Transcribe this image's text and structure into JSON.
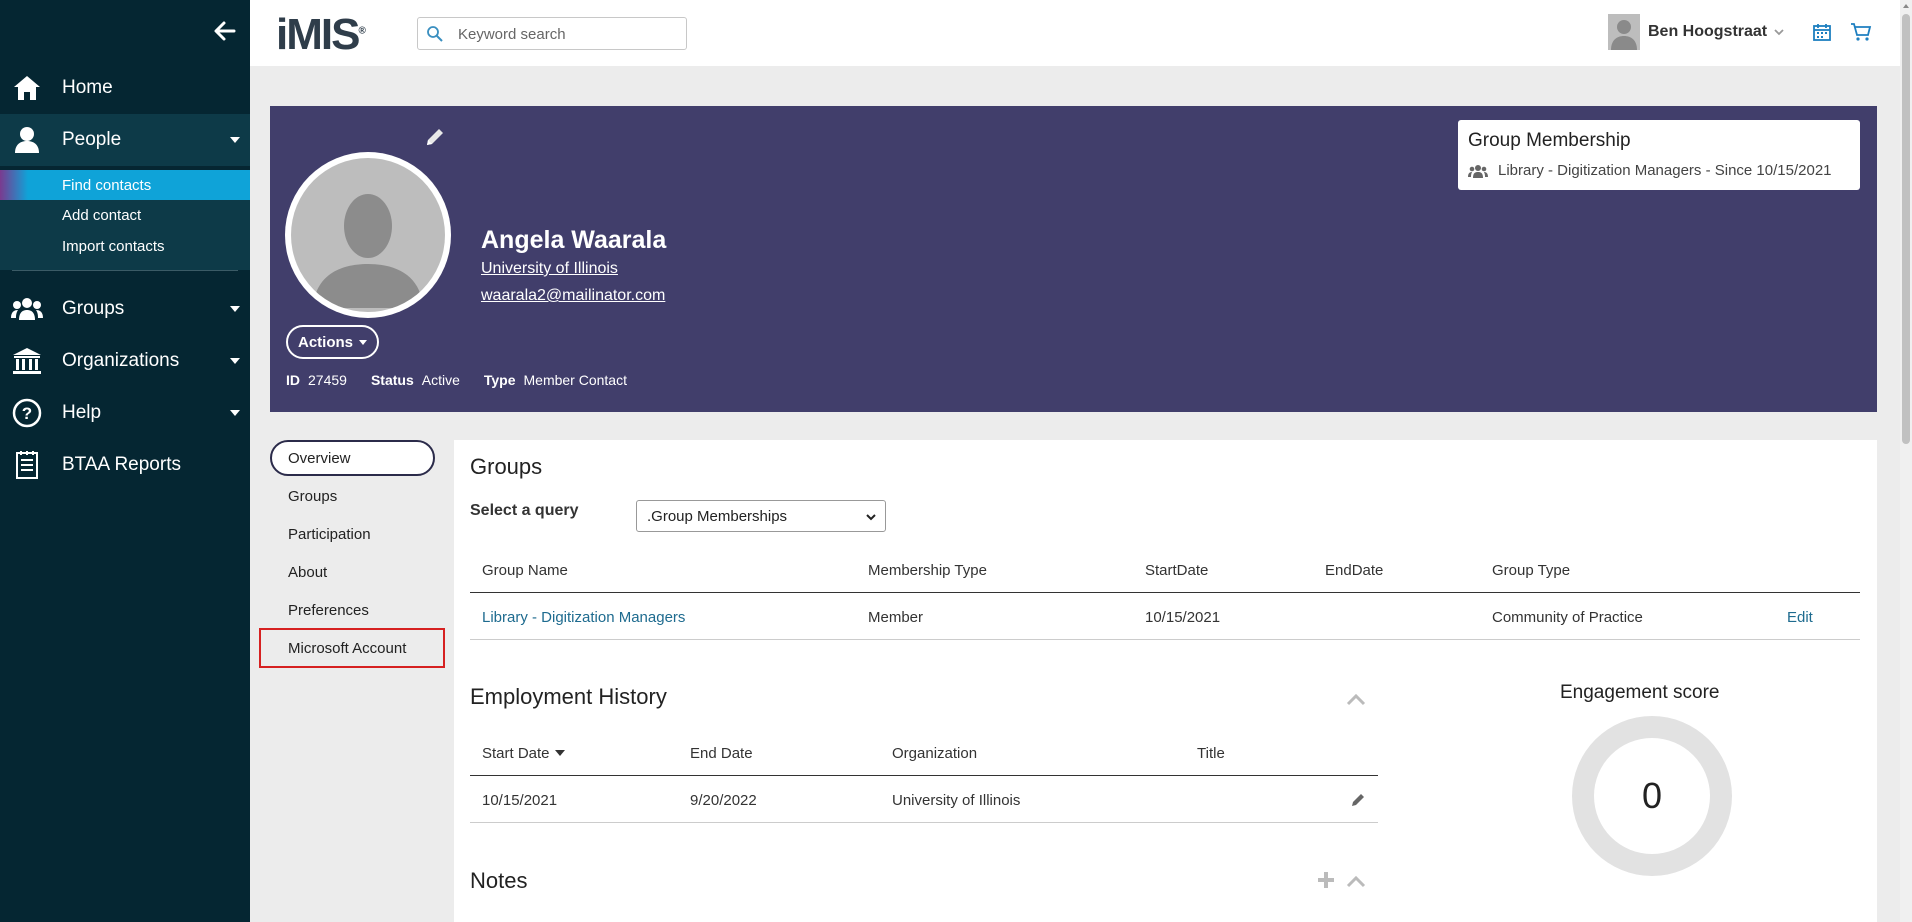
{
  "sidebar": {
    "nav": [
      {
        "label": "Home",
        "icon": "home-icon"
      },
      {
        "label": "People",
        "icon": "person-icon"
      },
      {
        "label": "Groups",
        "icon": "groups-icon"
      },
      {
        "label": "Organizations",
        "icon": "building-icon"
      },
      {
        "label": "Help",
        "icon": "help-icon"
      },
      {
        "label": "BTAA Reports",
        "icon": "report-icon"
      }
    ],
    "people_sub": [
      {
        "label": "Find contacts"
      },
      {
        "label": "Add contact"
      },
      {
        "label": "Import contacts"
      }
    ]
  },
  "topbar": {
    "logo_text": "iMIS",
    "logo_mark": "®",
    "search_placeholder": "Keyword search",
    "user_name": "Ben Hoogstraat"
  },
  "profile": {
    "name": "Angela Waarala",
    "organization": "University of Illinois",
    "email": "waarala2@mailinator.com",
    "actions_label": "Actions",
    "id_label": "ID",
    "id_value": "27459",
    "status_label": "Status",
    "status_value": "Active",
    "type_label": "Type",
    "type_value": "Member Contact",
    "group_card": {
      "title": "Group Membership",
      "line": "Library - Digitization Managers - Since 10/15/2021"
    }
  },
  "tabs": [
    {
      "label": "Overview"
    },
    {
      "label": "Groups"
    },
    {
      "label": "Participation"
    },
    {
      "label": "About"
    },
    {
      "label": "Preferences"
    },
    {
      "label": "Microsoft Account"
    }
  ],
  "groups_section": {
    "title": "Groups",
    "query_label": "Select a query",
    "query_value": ".Group Memberships",
    "columns": [
      "Group Name",
      "Membership Type",
      "StartDate",
      "EndDate",
      "Group Type"
    ],
    "rows": [
      {
        "group_name": "Library - Digitization Managers",
        "membership_type": "Member",
        "start": "10/15/2021",
        "end": "",
        "group_type": "Community of Practice",
        "action": "Edit"
      }
    ]
  },
  "employment_section": {
    "title": "Employment History",
    "columns": [
      "Start Date",
      "End Date",
      "Organization",
      "Title"
    ],
    "rows": [
      {
        "start": "10/15/2021",
        "end": "9/20/2022",
        "organization": "University of Illinois",
        "title": ""
      }
    ]
  },
  "notes_section": {
    "title": "Notes"
  },
  "engagement": {
    "title": "Engagement score",
    "score": "0"
  },
  "colors": {
    "sidebar_bg": "#052632",
    "header_bg": "#413e6b",
    "active_sub": "#0fa3d8",
    "link": "#1e6b8f",
    "highlight_border": "#d62121"
  }
}
